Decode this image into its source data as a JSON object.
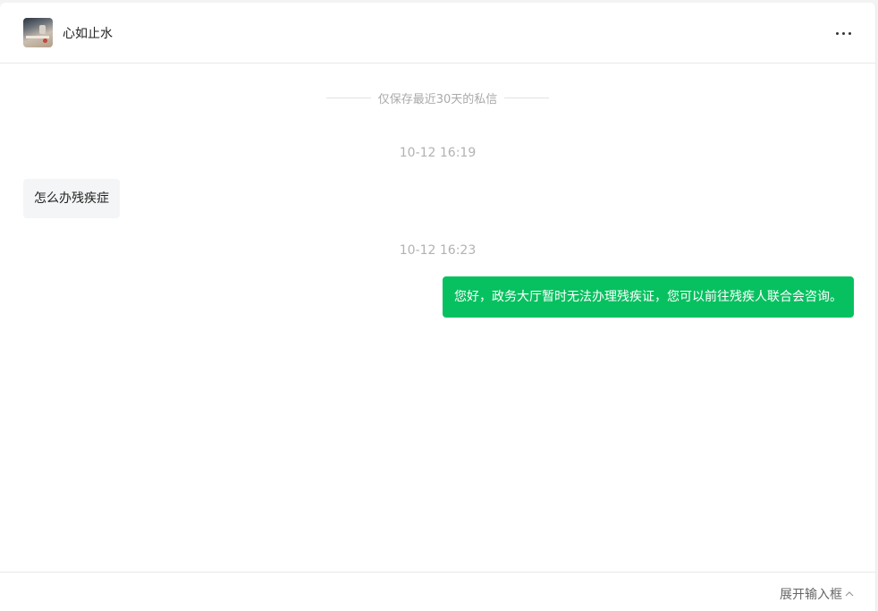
{
  "header": {
    "contact_name": "心如止水",
    "avatar_icon": "contact-avatar",
    "more_icon": "more-horizontal-icon"
  },
  "chat": {
    "notice": "仅保存最近30天的私信",
    "messages": [
      {
        "time": "10-12 16:19",
        "direction": "incoming",
        "text": "怎么办残疾症"
      },
      {
        "time": "10-12 16:23",
        "direction": "outgoing",
        "text": "您好，政务大厅暂时无法办理残疾证，您可以前往残疾人联合会咨询。"
      }
    ]
  },
  "footer": {
    "expand_label": "展开输入框",
    "expand_icon": "chevron-up-icon"
  },
  "colors": {
    "outgoing_bubble": "#07c160",
    "incoming_bubble": "#f4f5f7"
  }
}
